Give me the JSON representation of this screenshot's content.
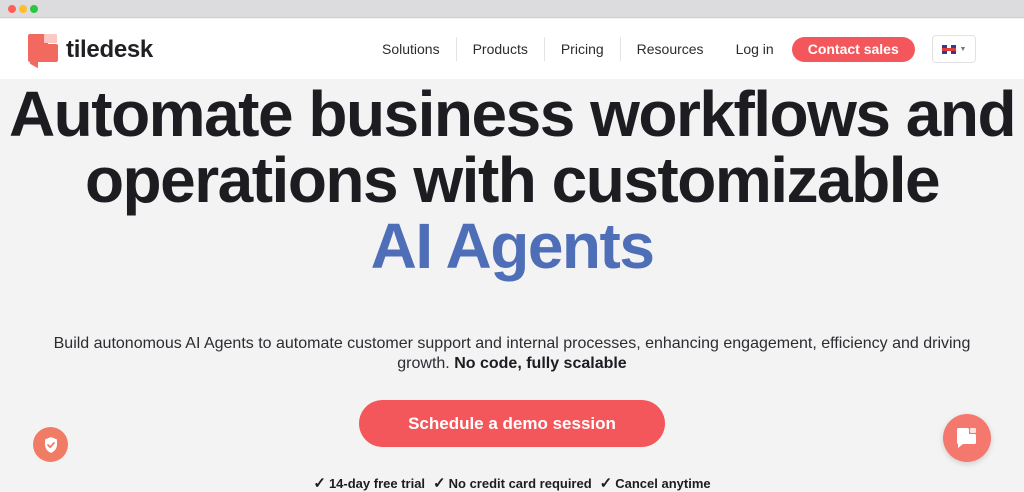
{
  "nav": {
    "logo_text": "tiledesk",
    "items": [
      "Solutions",
      "Products",
      "Pricing",
      "Resources"
    ],
    "login": "Log in",
    "contact": "Contact sales",
    "language_icon": "uk-flag-icon"
  },
  "hero": {
    "line1": "Automate business workflows and",
    "line2": "operations with customizable",
    "line3": "AI Agents",
    "subtitle_main": "Build autonomous AI Agents to automate customer support and internal processes, enhancing engagement, efficiency and driving growth.",
    "subtitle_bold": "No code, fully scalable",
    "cta": "Schedule a demo session",
    "perks": [
      "14-day free trial",
      "No credit card required",
      "Cancel anytime"
    ]
  },
  "colors": {
    "brand": "#f4575b",
    "accent": "#4f6eb8",
    "text": "#1c1c21"
  },
  "widgets": {
    "privacy_icon": "shield-check-icon",
    "chat_icon": "chat-bubble-icon"
  }
}
